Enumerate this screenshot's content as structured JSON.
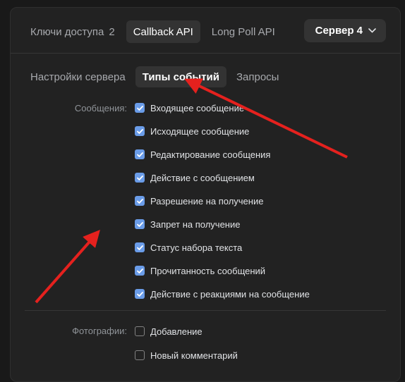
{
  "top_tabs": [
    {
      "label": "Ключи доступа",
      "count": "2"
    },
    {
      "label": "Callback API"
    },
    {
      "label": "Long Poll API"
    }
  ],
  "server_button": {
    "label": "Сервер 4",
    "icon": "chevron-down-icon"
  },
  "sub_tabs": [
    {
      "label": "Настройки сервера"
    },
    {
      "label": "Типы событий"
    },
    {
      "label": "Запросы"
    }
  ],
  "sections": {
    "messages": {
      "label": "Сообщения:",
      "items": [
        {
          "label": "Входящее сообщение",
          "checked": true
        },
        {
          "label": "Исходящее сообщение",
          "checked": true
        },
        {
          "label": "Редактирование сообщения",
          "checked": true
        },
        {
          "label": "Действие с сообщением",
          "checked": true
        },
        {
          "label": "Разрешение на получение",
          "checked": true
        },
        {
          "label": "Запрет на получение",
          "checked": true
        },
        {
          "label": "Статус набора текста",
          "checked": true
        },
        {
          "label": "Прочитанность сообщений",
          "checked": true
        },
        {
          "label": "Действие с реакциями на сообщение",
          "checked": true
        }
      ]
    },
    "photos": {
      "label": "Фотографии:",
      "items": [
        {
          "label": "Добавление",
          "checked": false
        },
        {
          "label": "Новый комментарий",
          "checked": false
        }
      ]
    }
  },
  "colors": {
    "accent": "#6a9ce8",
    "arrow": "#e5211e",
    "panel": "#222222"
  }
}
